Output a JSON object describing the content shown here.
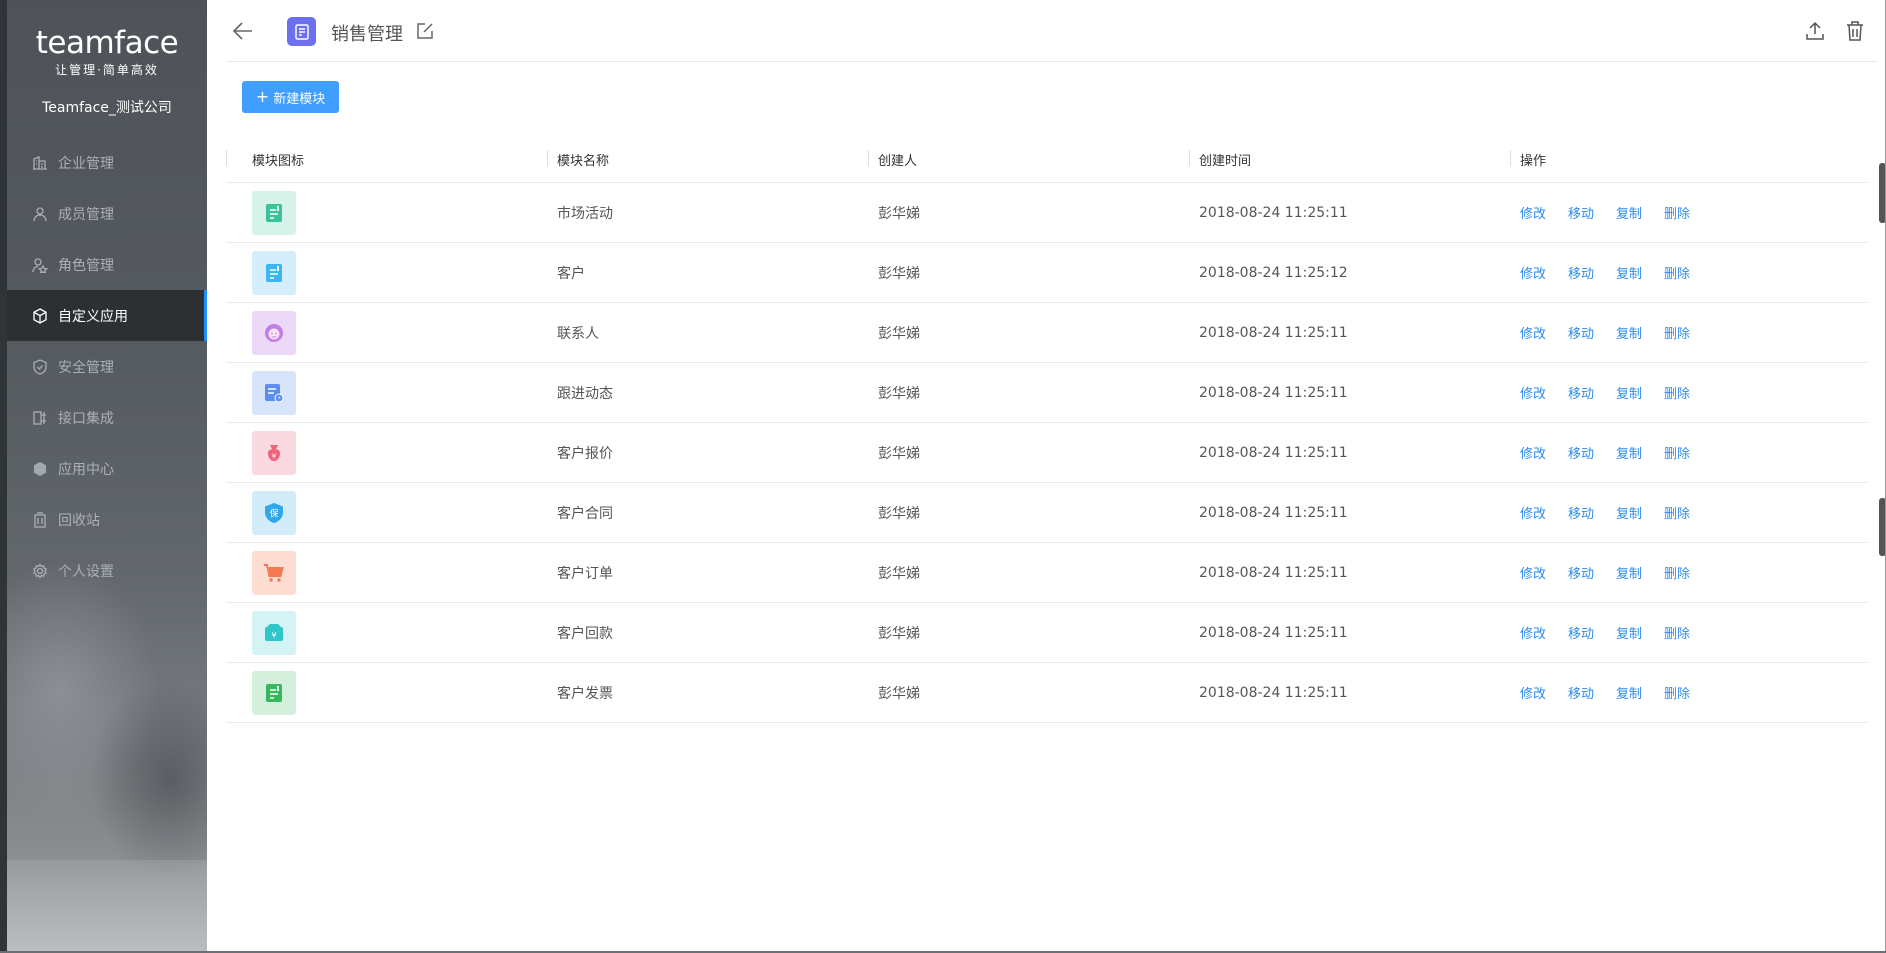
{
  "sidebar": {
    "brand": "teamface",
    "slogan": "让管理·简单高效",
    "company": "Teamface_测试公司",
    "items": [
      {
        "label": "企业管理",
        "icon": "building-icon",
        "active": false
      },
      {
        "label": "成员管理",
        "icon": "user-icon",
        "active": false
      },
      {
        "label": "角色管理",
        "icon": "role-icon",
        "active": false
      },
      {
        "label": "自定义应用",
        "icon": "cube-icon",
        "active": true
      },
      {
        "label": "安全管理",
        "icon": "shield-icon",
        "active": false
      },
      {
        "label": "接口集成",
        "icon": "plug-icon",
        "active": false
      },
      {
        "label": "应用中心",
        "icon": "box-icon",
        "active": false
      },
      {
        "label": "回收站",
        "icon": "trash-icon",
        "active": false
      },
      {
        "label": "个人设置",
        "icon": "gear-icon",
        "active": false
      }
    ]
  },
  "header": {
    "title": "销售管理"
  },
  "toolbar": {
    "new_module_label": "新建模块"
  },
  "table": {
    "columns": [
      "模块图标",
      "模块名称",
      "创建人",
      "创建时间",
      "操作"
    ],
    "actions": [
      "修改",
      "移动",
      "复制",
      "删除"
    ],
    "rows": [
      {
        "icon": "document-icon",
        "icon_bg": "#d6f2e9",
        "icon_fg": "#3ac29a",
        "name": "市场活动",
        "creator": "彭华娣",
        "created": "2018-08-24 11:25:11"
      },
      {
        "icon": "document-icon",
        "icon_bg": "#d4eefb",
        "icon_fg": "#3cb5f0",
        "name": "客户",
        "creator": "彭华娣",
        "created": "2018-08-24 11:25:12"
      },
      {
        "icon": "person-face-icon",
        "icon_bg": "#ecd9f7",
        "icon_fg": "#c07ee6",
        "name": "联系人",
        "creator": "彭华娣",
        "created": "2018-08-24 11:25:11"
      },
      {
        "icon": "document-clock-icon",
        "icon_bg": "#d7e4fa",
        "icon_fg": "#5b8ef0",
        "name": "跟进动态",
        "creator": "彭华娣",
        "created": "2018-08-24 11:25:11"
      },
      {
        "icon": "money-bag-icon",
        "icon_bg": "#fbd9e0",
        "icon_fg": "#f0647e",
        "name": "客户报价",
        "creator": "彭华娣",
        "created": "2018-08-24 11:25:11"
      },
      {
        "icon": "shield-badge-icon",
        "icon_bg": "#d3ecfa",
        "icon_fg": "#2fa7ea",
        "name": "客户合同",
        "creator": "彭华娣",
        "created": "2018-08-24 11:25:11"
      },
      {
        "icon": "cart-icon",
        "icon_bg": "#fddcd1",
        "icon_fg": "#f47b4f",
        "name": "客户订单",
        "creator": "彭华娣",
        "created": "2018-08-24 11:25:11"
      },
      {
        "icon": "wallet-icon",
        "icon_bg": "#d3f3f4",
        "icon_fg": "#2fc6c9",
        "name": "客户回款",
        "creator": "彭华娣",
        "created": "2018-08-24 11:25:11"
      },
      {
        "icon": "document-icon",
        "icon_bg": "#d4f0dc",
        "icon_fg": "#36b95c",
        "name": "客户发票",
        "creator": "彭华娣",
        "created": "2018-08-24 11:25:11"
      }
    ]
  }
}
